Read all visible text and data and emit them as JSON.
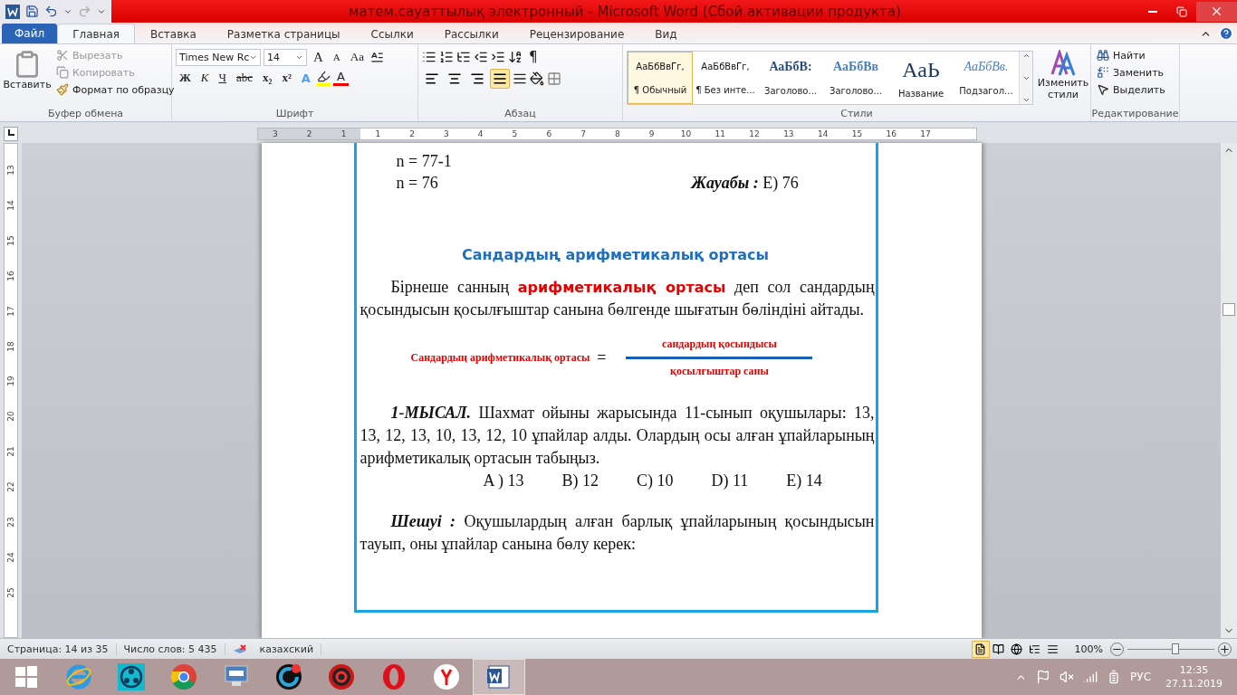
{
  "window": {
    "title": "матем.сауаттылық электронный  -  Microsoft Word (Сбой активации продукта)"
  },
  "file_tab": "Файл",
  "tabs": [
    {
      "label": "Главная",
      "selected": true
    },
    {
      "label": "Вставка",
      "selected": false
    },
    {
      "label": "Разметка страницы",
      "selected": false
    },
    {
      "label": "Ссылки",
      "selected": false
    },
    {
      "label": "Рассылки",
      "selected": false
    },
    {
      "label": "Рецензирование",
      "selected": false
    },
    {
      "label": "Вид",
      "selected": false
    }
  ],
  "ribbon": {
    "clipboard": {
      "label": "Буфер обмена",
      "paste": "Вставить",
      "actions": [
        {
          "kind": "cut",
          "label": "Вырезать",
          "disabled": true
        },
        {
          "kind": "copy",
          "label": "Копировать",
          "disabled": true
        },
        {
          "kind": "painter",
          "label": "Формат по образцу",
          "disabled": false
        }
      ]
    },
    "font": {
      "label": "Шрифт",
      "font_name": "Times New Rc",
      "font_size": "14",
      "grow": "A",
      "shrink": "A",
      "change_case": "Aa",
      "format_buttons": [
        "Ж",
        "К",
        "Ч",
        "abc",
        "x₂",
        "x²"
      ],
      "effects": "A",
      "font_color": "A"
    },
    "paragraph": {
      "label": "Абзац",
      "pilcrow": "¶",
      "alignment": [
        {
          "kind": "left",
          "selected": false
        },
        {
          "kind": "center",
          "selected": false
        },
        {
          "kind": "right",
          "selected": false
        },
        {
          "kind": "justify",
          "selected": true
        }
      ]
    },
    "styles": {
      "label": "Стили",
      "items": [
        {
          "preview": "АаБбВвГг,",
          "label": "¶ Обычный",
          "kind": "normal",
          "selected": true
        },
        {
          "preview": "АаБбВвГг,",
          "label": "¶ Без инте...",
          "kind": "normal",
          "selected": false
        },
        {
          "preview": "АаБбВ:",
          "label": "Заголово...",
          "kind": "heading1",
          "selected": false
        },
        {
          "preview": "АаБбВв",
          "label": "Заголово...",
          "kind": "heading2",
          "selected": false
        },
        {
          "preview": "АаЬ",
          "label": "Название",
          "kind": "title",
          "selected": false
        },
        {
          "preview": "АаБбВв.",
          "label": "Подзагол...",
          "kind": "subtitle",
          "selected": false
        }
      ],
      "change": "Изменить стили"
    },
    "editing": {
      "label": "Редактирование",
      "actions": [
        {
          "kind": "find",
          "label": "Найти"
        },
        {
          "kind": "replace",
          "label": "Заменить"
        },
        {
          "kind": "select",
          "label": "Выделить"
        }
      ]
    }
  },
  "rulers": {
    "horizontal": [
      "3",
      "2",
      "1",
      "1",
      "2",
      "3",
      "4",
      "5",
      "6",
      "7",
      "8",
      "9",
      "10",
      "11",
      "12",
      "13",
      "14",
      "15",
      "16",
      "17"
    ],
    "vertical": [
      "13",
      "14",
      "15",
      "16",
      "17",
      "18",
      "19",
      "20",
      "21",
      "22",
      "23",
      "24",
      "25"
    ]
  },
  "document": {
    "lines": [
      "n = 77-1",
      "n = 76"
    ],
    "answer_label": "Жауабы :",
    "answer_value": "E) 76",
    "heading": "Сандардың арифметикалық ортасы",
    "definition": "Бірнеше санның **арифметикалық ортасы** деп сол сандардың қосындысын қосылғыштар санына бөлгенде шығатын бөліндіні айтады.",
    "formula": {
      "left": "Сандардың арифметикалық ортасы",
      "equals": "=",
      "numerator": "сандардың қосындысы",
      "denominator": "қосылғыштар саны"
    },
    "example_label": "1-МЫСАЛ.",
    "example_text": "Шахмат ойыны жарысында 11-сынып оқушылары: 13, 13, 12, 13, 10, 13, 12, 10 ұпайлар алды. Олардың осы алған ұпайларының арифметикалық ортасын табыңыз.",
    "options": [
      "A ) 13",
      "B) 12",
      "C) 10",
      "D) 11",
      "E) 14"
    ],
    "solution_label": "Шешуі :",
    "solution_text": "Оқушылардың алған барлық ұпайларының қосындысын тауып, оны ұпайлар санына бөлу керек:"
  },
  "status_bar": {
    "page": "Страница: 14 из 35",
    "words": "Число слов: 5 435",
    "language": "казахский",
    "views": [
      {
        "kind": "print",
        "selected": true
      },
      {
        "kind": "read",
        "selected": false
      },
      {
        "kind": "web",
        "selected": false
      },
      {
        "kind": "outline",
        "selected": false
      },
      {
        "kind": "draft",
        "selected": false
      }
    ],
    "zoom": "100%",
    "zoom_slider": {
      "level": 0.55
    }
  },
  "taskbar": {
    "apps": [
      {
        "kind": "ie",
        "active": false
      },
      {
        "kind": "share",
        "active": false
      },
      {
        "kind": "chrome",
        "active": false
      },
      {
        "kind": "keyboard",
        "active": false
      },
      {
        "kind": "cleaner",
        "active": false
      },
      {
        "kind": "booster",
        "active": false
      },
      {
        "kind": "opera",
        "active": false
      },
      {
        "kind": "yandex",
        "active": false
      },
      {
        "kind": "word",
        "active": true
      }
    ],
    "tray": {
      "language": "РУС",
      "time": "12:35",
      "date": "27.11.2019"
    }
  }
}
